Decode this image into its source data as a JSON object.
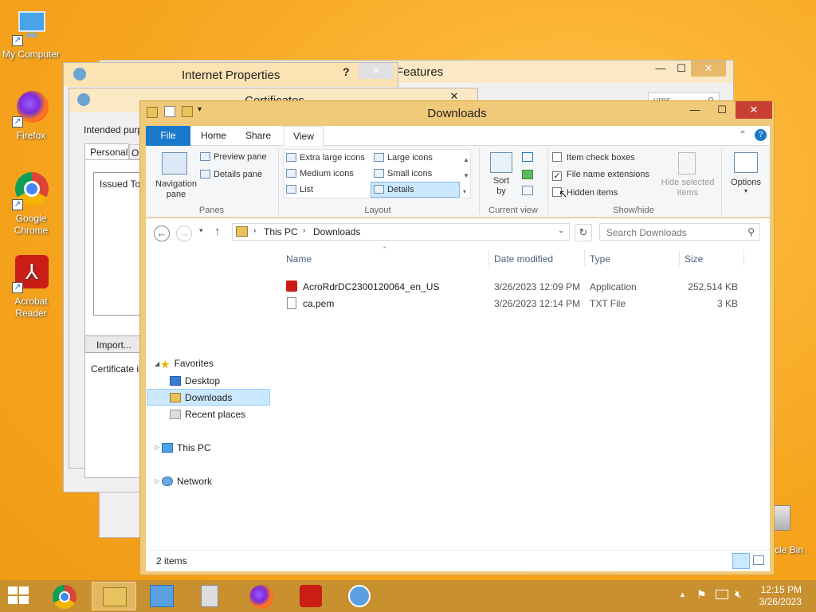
{
  "desktop": {
    "icons": [
      {
        "label": "My Computer"
      },
      {
        "label": "Firefox"
      },
      {
        "label": "Google Chrome"
      },
      {
        "label": "Acrobat Reader"
      },
      {
        "label": "cle Bin"
      }
    ]
  },
  "bg_windows": {
    "internet_properties": {
      "title": "Internet Properties",
      "help": "?",
      "close": "✕"
    },
    "certificates": {
      "title": "Certificates",
      "intended_label": "Intended purp",
      "tab_personal": "Personal",
      "tab_other": "O",
      "issued_to": "Issued To",
      "import_btn": "Import...",
      "cert_info": "Certificate in"
    },
    "features": {
      "title": "Features",
      "search_fragment": "ures"
    }
  },
  "explorer": {
    "title": "Downloads",
    "tabs": {
      "file": "File",
      "home": "Home",
      "share": "Share",
      "view": "View"
    },
    "ribbon": {
      "panes": {
        "nav_pane": "Navigation\npane",
        "preview_pane": "Preview pane",
        "details_pane": "Details pane",
        "group": "Panes"
      },
      "layout": {
        "xl_icons": "Extra large icons",
        "large_icons": "Large icons",
        "medium_icons": "Medium icons",
        "small_icons": "Small icons",
        "list": "List",
        "details": "Details",
        "group": "Layout"
      },
      "current_view": {
        "sort_by": "Sort\nby",
        "group": "Current view"
      },
      "show_hide": {
        "item_checkboxes": "Item check boxes",
        "file_name_extensions": "File name extensions",
        "hidden_items": "Hidden items",
        "hide_selected": "Hide selected\nitems",
        "group": "Show/hide",
        "checked": {
          "item_checkboxes": false,
          "file_name_extensions": true,
          "hidden_items": false
        }
      },
      "options": "Options"
    },
    "address": {
      "crumbs": [
        "This PC",
        "Downloads"
      ],
      "search_placeholder": "Search Downloads"
    },
    "nav": {
      "favorites": "Favorites",
      "desktop": "Desktop",
      "downloads": "Downloads",
      "recent": "Recent places",
      "this_pc": "This PC",
      "network": "Network"
    },
    "columns": {
      "name": "Name",
      "date": "Date modified",
      "type": "Type",
      "size": "Size"
    },
    "files": [
      {
        "name": "AcroRdrDC2300120064_en_US",
        "date": "3/26/2023 12:09 PM",
        "type": "Application",
        "size": "252,514 KB",
        "icon": "acrobat-installer-icon"
      },
      {
        "name": "ca.pem",
        "date": "3/26/2023 12:14 PM",
        "type": "TXT File",
        "size": "3 KB",
        "icon": "text-file-icon"
      }
    ],
    "status": "2 items"
  },
  "taskbar": {
    "time": "12:15 PM",
    "date": "3/26/2023"
  },
  "colors": {
    "desktop": "#f7a620",
    "window_frame": "#f0c979",
    "file_tab": "#1979ca",
    "close_button": "#c84031",
    "selection": "#cce8ff"
  }
}
